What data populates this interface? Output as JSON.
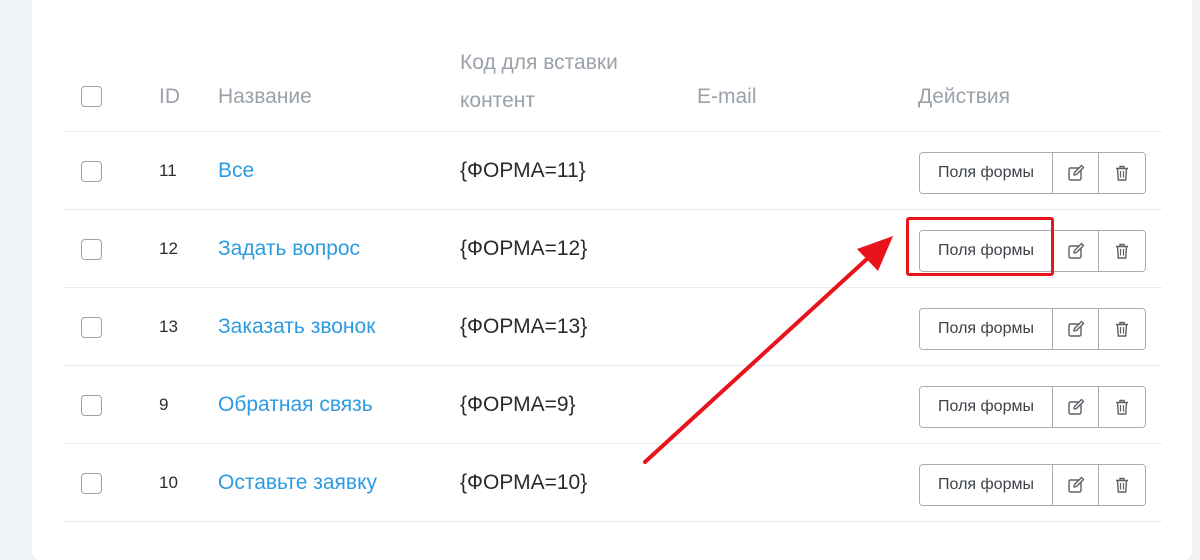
{
  "table": {
    "headers": {
      "id": "ID",
      "name": "Название",
      "code_line1": "Код для вставки",
      "code_line2": "контент",
      "email": "E-mail",
      "actions": "Действия"
    },
    "rows": [
      {
        "id": "11",
        "name": "Все",
        "code": "{ФОРМА=11}",
        "email": "",
        "fields_button": "Поля формы"
      },
      {
        "id": "12",
        "name": "Задать вопрос",
        "code": "{ФОРМА=12}",
        "email": "",
        "fields_button": "Поля формы"
      },
      {
        "id": "13",
        "name": "Заказать звонок",
        "code": "{ФОРМА=13}",
        "email": "",
        "fields_button": "Поля формы"
      },
      {
        "id": "9",
        "name": "Обратная связь",
        "code": "{ФОРМА=9}",
        "email": "",
        "fields_button": "Поля формы"
      },
      {
        "id": "10",
        "name": "Оставьте заявку",
        "code": "{ФОРМА=10}",
        "email": "",
        "fields_button": "Поля формы"
      }
    ]
  },
  "icons": {
    "edit": "edit-icon",
    "delete": "trash-icon"
  },
  "colors": {
    "link": "#2d9be0",
    "annotation": "#e8131b",
    "header_text": "#9aa1a8",
    "background": "#f1f4f6"
  }
}
